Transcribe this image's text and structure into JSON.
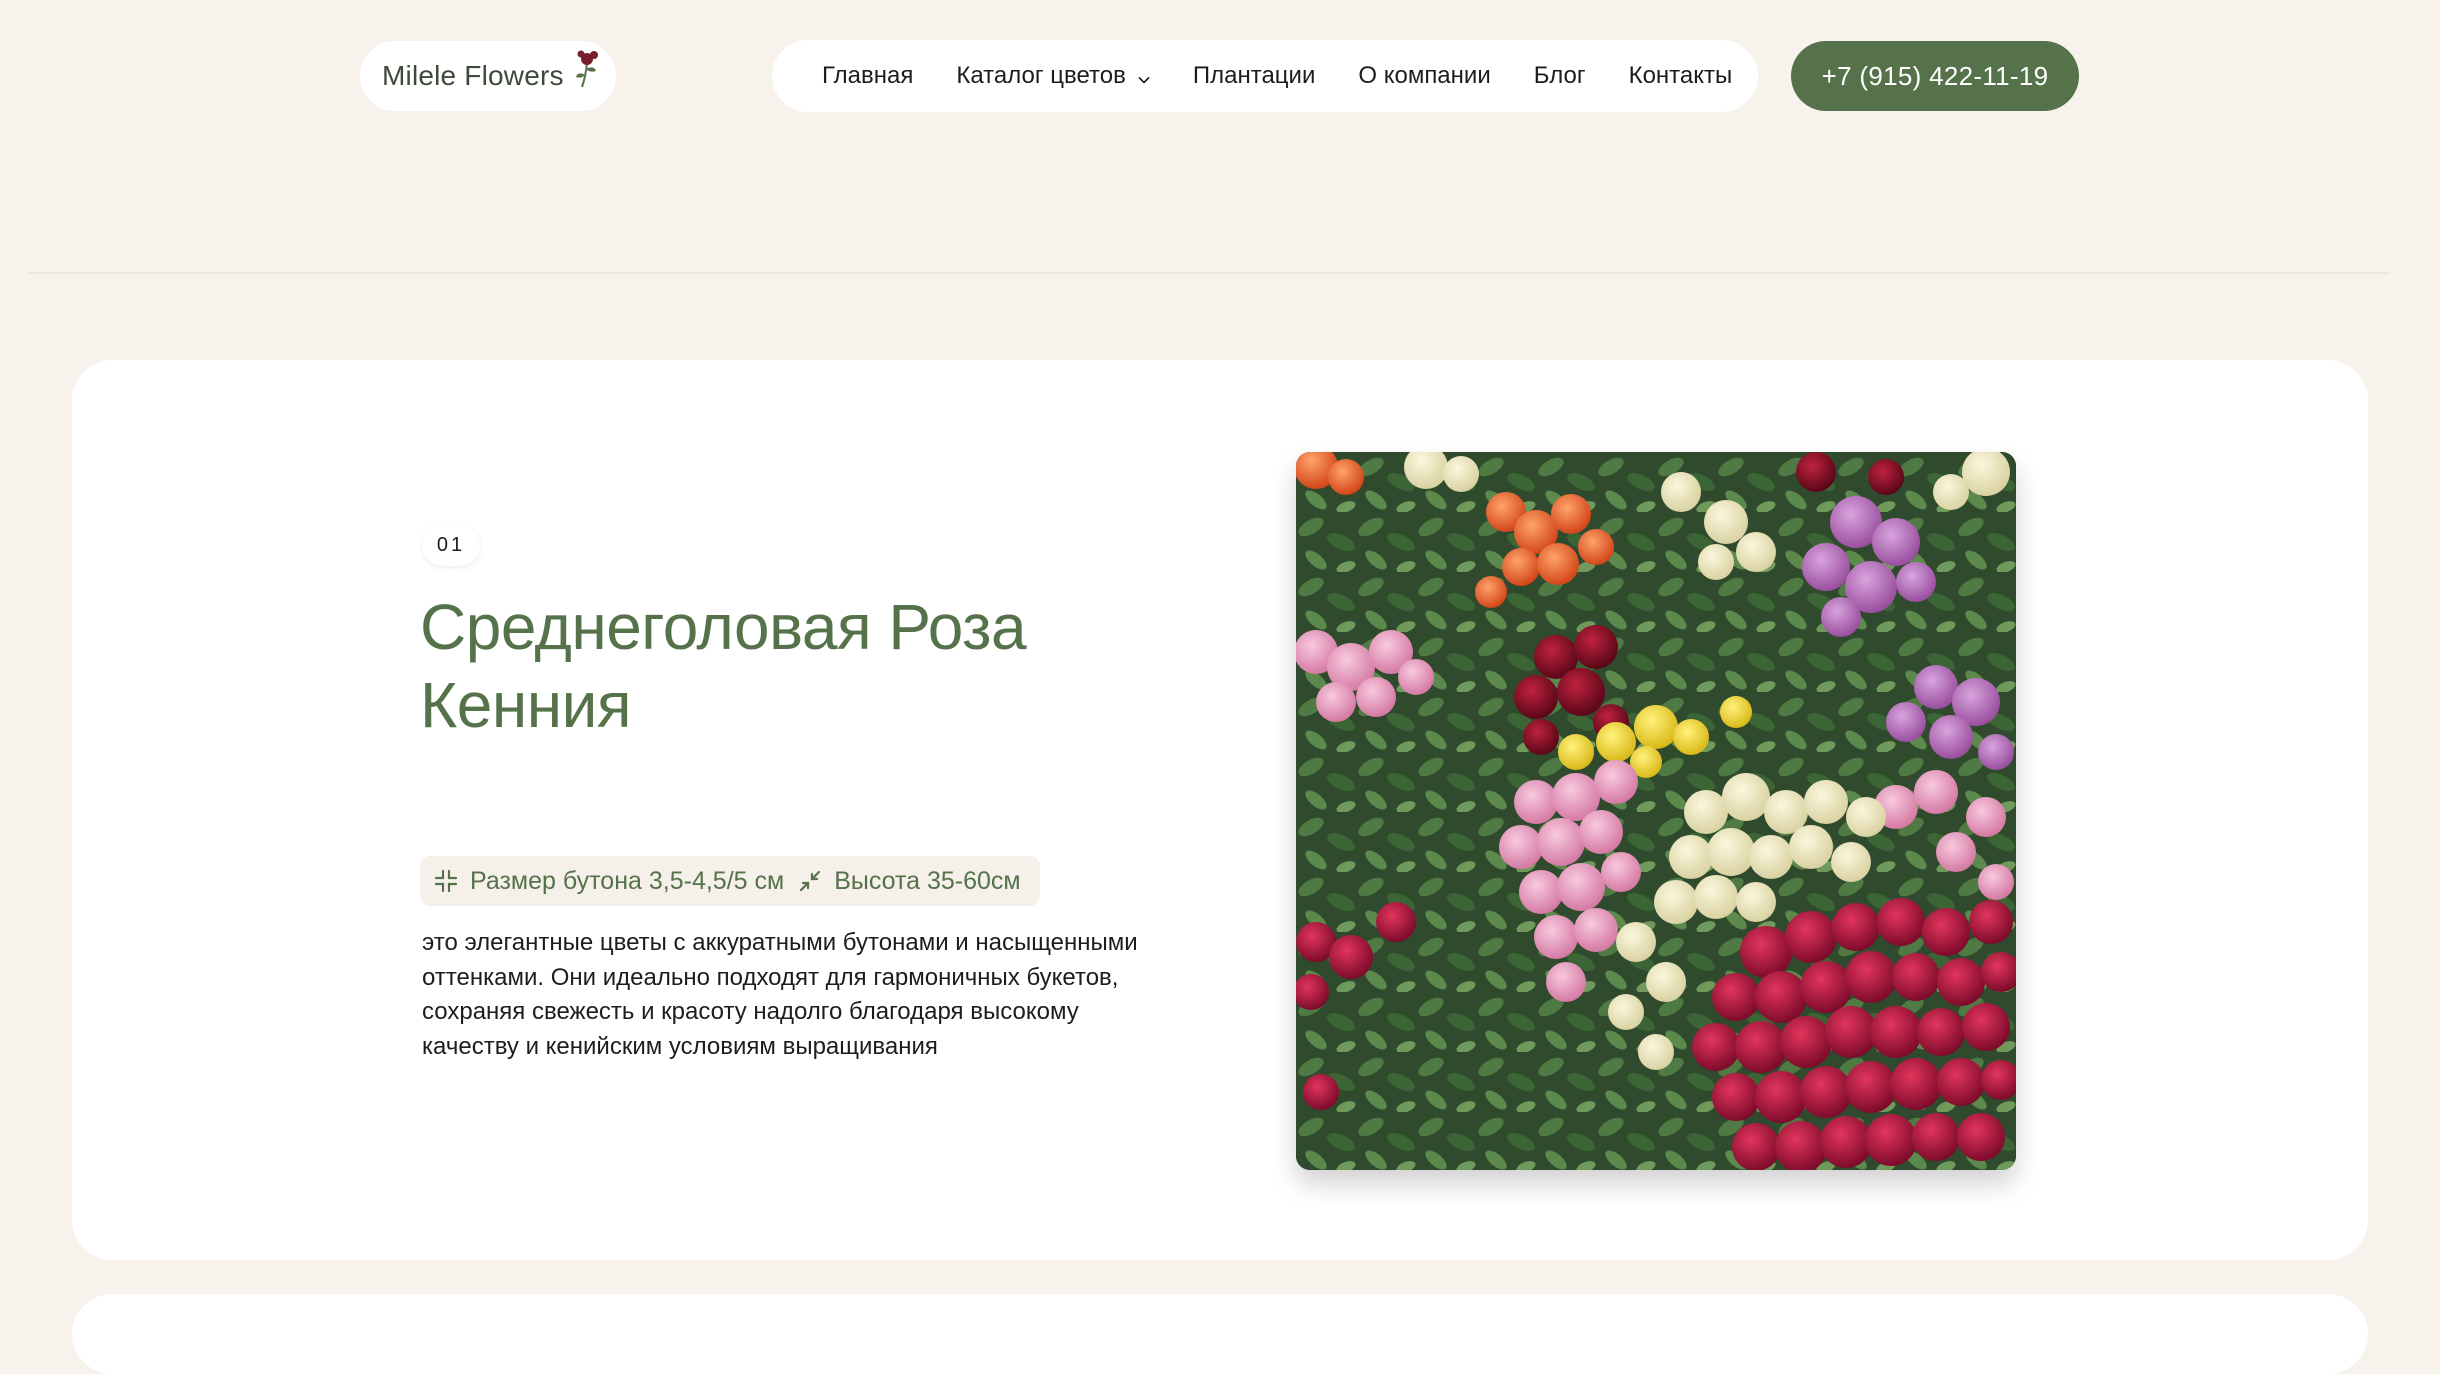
{
  "brand": {
    "logo_text": "Milele Flowers",
    "logo_icon": "rose-sprig-icon",
    "accent_color": "#55724a"
  },
  "nav": {
    "items": [
      {
        "label": "Главная"
      },
      {
        "label": "Каталог цветов",
        "has_dropdown": true
      },
      {
        "label": "Плантации"
      },
      {
        "label": "О компании"
      },
      {
        "label": "Блог"
      },
      {
        "label": "Контакты"
      }
    ]
  },
  "header": {
    "phone": "+7 (915) 422-11-19"
  },
  "product": {
    "number": "01",
    "title": "Среднеголовая Роза Кенния",
    "specs": [
      {
        "icon": "compress-arrows-icon",
        "text": "Размер бутона 3,5-4,5/5 см"
      },
      {
        "icon": "diagonal-arrows-icon",
        "text": "Высота 35-60см"
      }
    ],
    "description": "это элегантные цветы с аккуратными бутонами и насыщенными оттенками. Они идеально подходят для гармоничных букетов, сохраняя свежесть и красоту надолго благодаря высокому качеству и кенийским условиям выращивания",
    "image": "roses-assortment-photo"
  }
}
